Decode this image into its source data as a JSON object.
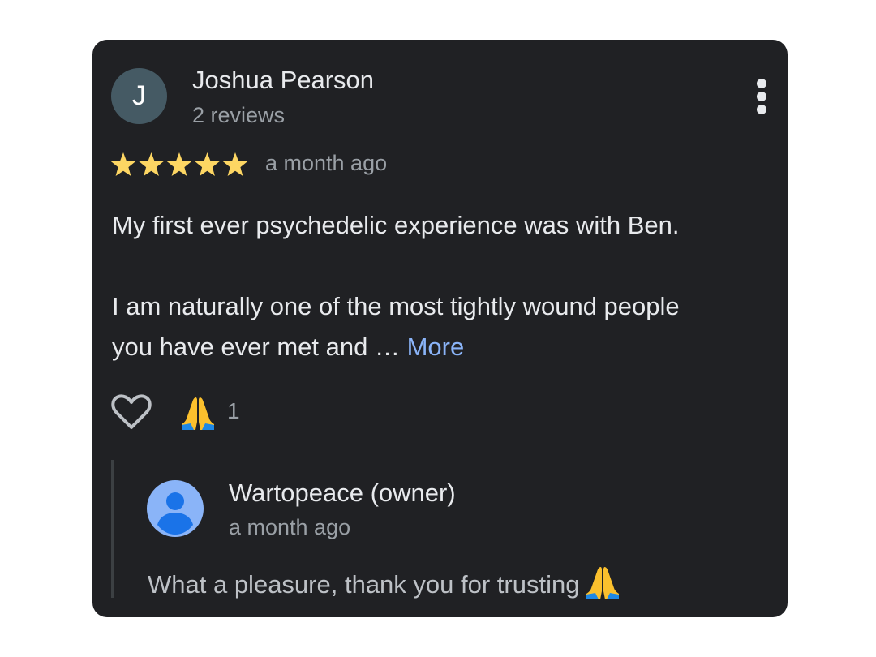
{
  "review": {
    "avatar_letter": "J",
    "reviewer_name": "Joshua Pearson",
    "review_count": "2 reviews",
    "rating": 5,
    "rating_max": 5,
    "time": "a month ago",
    "paragraph1": "My first ever psychedelic experience was with Ben.",
    "paragraph2_line1": "I am naturally one of the most tightly wound people",
    "paragraph2_line2": "you have ever met and …",
    "more_label": "More",
    "reaction_emoji": "folded-hands-icon",
    "reaction_count": "1"
  },
  "reply": {
    "owner_name": "Wartopeace (owner)",
    "time": "a month ago",
    "text": "What a pleasure, thank you for trusting"
  },
  "colors": {
    "card_background": "#202124",
    "star": "#fdd663",
    "link": "#8ab4f8",
    "avatar_reviewer": "#455a64",
    "avatar_owner": "#8ab4f8"
  }
}
